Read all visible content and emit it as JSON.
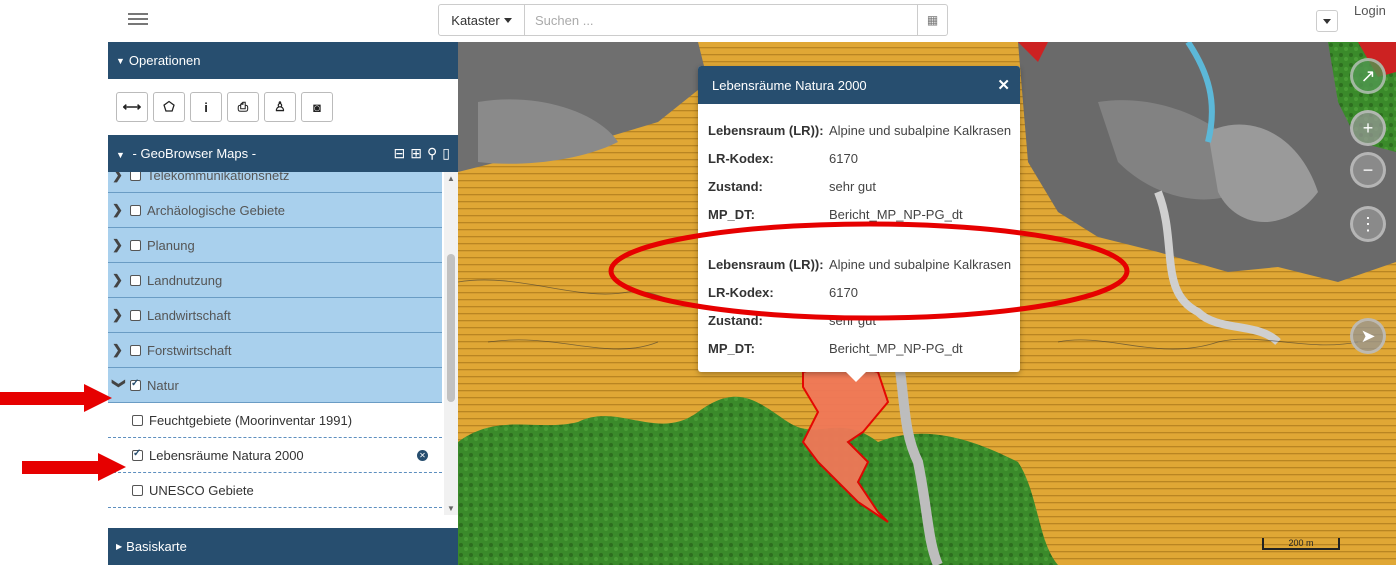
{
  "topbar": {
    "search_scope": "Kataster",
    "search_placeholder": "Suchen ...",
    "login": "Login"
  },
  "sidebar": {
    "operations_title": "Operationen",
    "maps_title": "- GeoBrowser Maps -",
    "layers": [
      {
        "label": "Telekommunikationsnetz",
        "checked": false
      },
      {
        "label": "Archäologische Gebiete",
        "checked": false
      },
      {
        "label": "Planung",
        "checked": false
      },
      {
        "label": "Landnutzung",
        "checked": false
      },
      {
        "label": "Landwirtschaft",
        "checked": false
      },
      {
        "label": "Forstwirtschaft",
        "checked": false
      },
      {
        "label": "Natur",
        "checked": true,
        "expanded": true
      }
    ],
    "natur_sublayers": [
      {
        "label": "Feuchtgebiete (Moorinventar 1991)",
        "checked": false
      },
      {
        "label": "Lebensräume Natura 2000",
        "checked": true
      },
      {
        "label": "UNESCO Gebiete",
        "checked": false
      }
    ],
    "basemap_title": "Basiskarte"
  },
  "popup": {
    "title": "Lebensräume Natura 2000",
    "records": [
      {
        "lebensraum_key": "Lebensraum (LR)):",
        "lebensraum": "Alpine und subalpine Kalkrasen",
        "kodex_key": "LR-Kodex:",
        "kodex": "6170",
        "zustand_key": "Zustand:",
        "zustand": "sehr gut",
        "mpdt_key": "MP_DT:",
        "mpdt": "Bericht_MP_NP-PG_dt"
      },
      {
        "lebensraum_key": "Lebensraum (LR)):",
        "lebensraum": "Alpine und subalpine Kalkrasen",
        "kodex_key": "LR-Kodex:",
        "kodex": "6170",
        "zustand_key": "Zustand:",
        "zustand": "sehr gut",
        "mpdt_key": "MP_DT:",
        "mpdt": "Bericht_MP_NP-PG_dt"
      }
    ]
  },
  "map": {
    "scale_label": "200 m"
  },
  "colors": {
    "header": "#274e6f",
    "layer_bg": "#a9d0ed",
    "annotation_red": "#e60000",
    "forest": "#3f8a2f",
    "grassland": "#e1a937",
    "rock": "#6e6e6e"
  }
}
